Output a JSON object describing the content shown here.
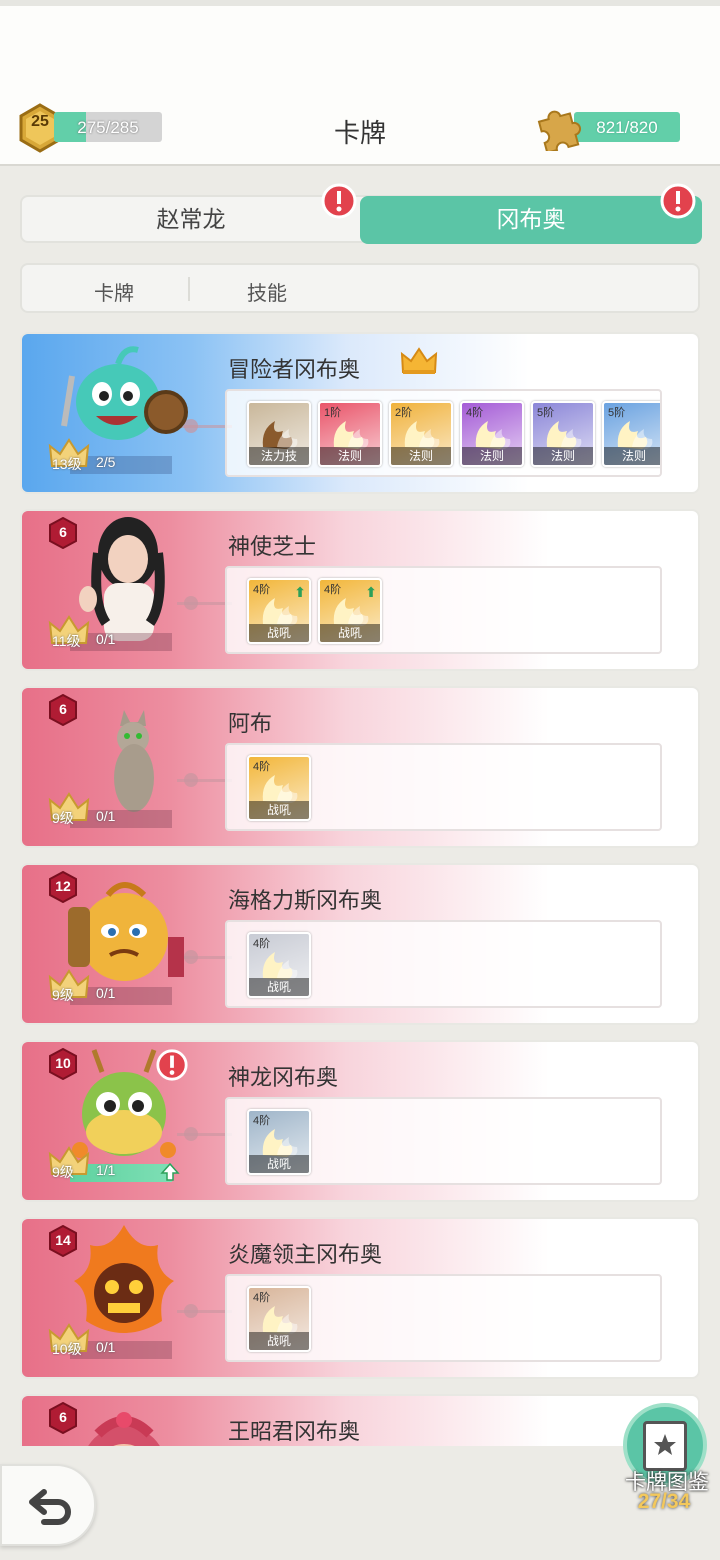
{
  "header": {
    "title": "卡牌",
    "player_level": "25",
    "xp_text": "275/285",
    "xp_fraction": 0.3,
    "puzzle_text": "821/820"
  },
  "player_tabs": [
    {
      "label": "赵常龙",
      "alert": true,
      "selected": false
    },
    {
      "label": "冈布奥",
      "alert": true,
      "selected": true
    }
  ],
  "sub_tabs": [
    {
      "label": "卡牌"
    },
    {
      "label": "技能"
    }
  ],
  "cards": [
    {
      "name": "冒险者冈布奥",
      "style": "blue",
      "tier": "",
      "has_crown": true,
      "level_label": "13级",
      "progress": "2/5",
      "avatar_icon": "green-fish-knight-icon",
      "skills": [
        {
          "tier": "",
          "label": "法力技",
          "color": "#c9b79a"
        },
        {
          "tier": "1阶",
          "label": "法则",
          "color": "#e9556a"
        },
        {
          "tier": "2阶",
          "label": "法则",
          "color": "#f0b23c"
        },
        {
          "tier": "4阶",
          "label": "法则",
          "color": "#a45bd6"
        },
        {
          "tier": "5阶",
          "label": "法则",
          "color": "#8b86d8"
        },
        {
          "tier": "5阶",
          "label": "法则",
          "color": "#6aa2e0"
        }
      ]
    },
    {
      "name": "神使芝士",
      "style": "pink",
      "tier": "6",
      "level_label": "11级",
      "progress": "0/1",
      "avatar_icon": "girl-portrait-icon",
      "skills": [
        {
          "tier": "4阶",
          "label": "战吼",
          "color": "#f2b63a",
          "upgrade": true
        },
        {
          "tier": "4阶",
          "label": "战吼",
          "color": "#f2b63a",
          "upgrade": true
        }
      ]
    },
    {
      "name": "阿布",
      "style": "pink",
      "tier": "6",
      "level_label": "9级",
      "progress": "0/1",
      "avatar_icon": "cat-icon",
      "skills": [
        {
          "tier": "4阶",
          "label": "战吼",
          "color": "#f2b63a"
        }
      ]
    },
    {
      "name": "海格力斯冈布奥",
      "style": "pink",
      "tier": "12",
      "level_label": "9级",
      "progress": "0/1",
      "avatar_icon": "golden-warrior-icon",
      "skills": [
        {
          "tier": "4阶",
          "label": "战吼",
          "color": "#c8cbd4"
        }
      ]
    },
    {
      "name": "神龙冈布奥",
      "style": "pink",
      "tier": "10",
      "alert": true,
      "level_label": "9级",
      "progress": "1/1",
      "level_up": true,
      "avatar_icon": "dragon-icon",
      "skills": [
        {
          "tier": "4阶",
          "label": "战吼",
          "color": "#9fb5c9"
        }
      ]
    },
    {
      "name": "炎魔领主冈布奥",
      "style": "pink",
      "tier": "14",
      "level_label": "10级",
      "progress": "0/1",
      "avatar_icon": "fire-demon-icon",
      "skills": [
        {
          "tier": "4阶",
          "label": "战吼",
          "color": "#d8b59a"
        }
      ]
    },
    {
      "name": "王昭君冈布奥",
      "style": "pink",
      "tier": "6",
      "level_label": "",
      "progress": "",
      "avatar_icon": "princess-icon",
      "skills": []
    }
  ],
  "footer": {
    "dex_label": "卡牌图鉴",
    "dex_count": "27/34"
  }
}
